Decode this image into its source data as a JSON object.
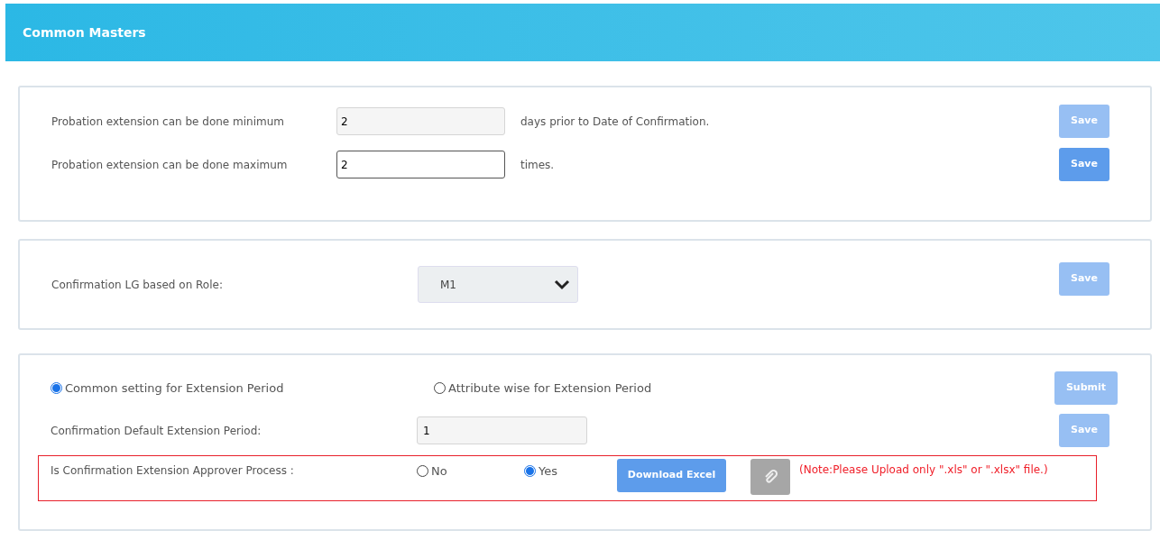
{
  "header": {
    "title": "Common Masters"
  },
  "probation": {
    "rows": [
      {
        "label": "Probation extension can be done minimum",
        "value": "2",
        "suffix": "days prior to Date of Confirmation.",
        "field_disabled": true,
        "save": {
          "label": "Save",
          "disabled": true
        }
      },
      {
        "label": "Probation extension can be done maximum",
        "value": "2",
        "suffix": "times.",
        "field_disabled": false,
        "save": {
          "label": "Save",
          "disabled": false
        }
      }
    ]
  },
  "role": {
    "label": "Confirmation LG based on Role:",
    "value": "M1",
    "save": {
      "label": "Save",
      "disabled": true
    }
  },
  "extension": {
    "radios": [
      {
        "label": "Common setting for Extension Period",
        "selected": true
      },
      {
        "label": "Attribute wise for Extension Period",
        "selected": false
      }
    ],
    "submit": {
      "label": "Submit",
      "disabled": true
    },
    "default_period": {
      "label": "Confirmation Default Extension Period:",
      "value": "1",
      "save": {
        "label": "Save",
        "disabled": true
      }
    },
    "approver": {
      "label": "Is Confirmation Extension Approver Process :",
      "options": [
        {
          "label": "No",
          "selected": false
        },
        {
          "label": "Yes",
          "selected": true
        }
      ],
      "download_label": "Download Excel",
      "note": "(Note:Please Upload only \".xls\" or \".xlsx\" file.)"
    }
  }
}
